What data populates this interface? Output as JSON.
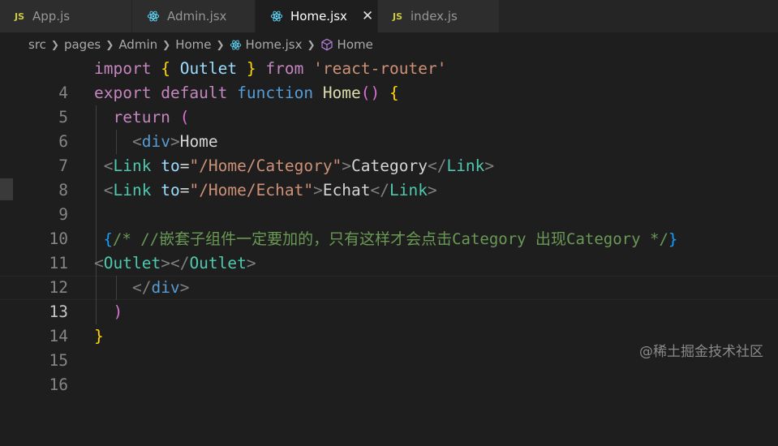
{
  "tabs": [
    {
      "label": "App.js",
      "icon": "js-icon",
      "icon_text": "JS"
    },
    {
      "label": "Admin.jsx",
      "icon": "react-icon"
    },
    {
      "label": "Home.jsx",
      "icon": "react-icon",
      "active": true
    },
    {
      "label": "index.js",
      "icon": "js-icon",
      "icon_text": "JS"
    }
  ],
  "breadcrumb": [
    "src",
    "pages",
    "Admin",
    "Home",
    "Home.jsx",
    "Home"
  ],
  "line_numbers": [
    "4",
    "5",
    "6",
    "7",
    "8",
    "9",
    "10",
    "11",
    "12",
    "13",
    "14",
    "15",
    "16"
  ],
  "code": {
    "l4": [
      "import",
      "{",
      "Outlet",
      "}",
      "from",
      "'react-router'"
    ],
    "l5": [
      "export",
      "default",
      "function",
      "Home",
      "()",
      "{"
    ],
    "l6": [
      "return",
      "("
    ],
    "l7": [
      "<",
      "div",
      ">",
      "Home"
    ],
    "l8": [
      "<",
      "Link",
      "to",
      "=",
      "\"/Home/Category\"",
      ">",
      "Category",
      "</",
      "Link",
      ">"
    ],
    "l9": [
      "<",
      "Link",
      "to",
      "=",
      "\"/Home/Echat\"",
      ">",
      "Echat",
      "</",
      "Link",
      ">"
    ],
    "l11": [
      "{",
      "/* //嵌套子组件一定要加的，只有这样才会点击Category 出现Category */",
      "}"
    ],
    "l12": [
      "<",
      "Outlet",
      ">",
      "</",
      "Outlet",
      ">"
    ],
    "l13": [
      "</",
      "div",
      ">"
    ],
    "l14": [
      ")"
    ],
    "l15": [
      "}"
    ]
  },
  "current_line": "13",
  "watermark": "@稀土掘金技术社区",
  "colors": {
    "background": "#1e1e1e",
    "keyword": "#c586c0",
    "storage": "#569cd6",
    "function": "#dcdcaa",
    "string": "#ce9178",
    "tag": "#4ec9b0",
    "attribute": "#9cdcfe",
    "comment": "#6a9955"
  }
}
